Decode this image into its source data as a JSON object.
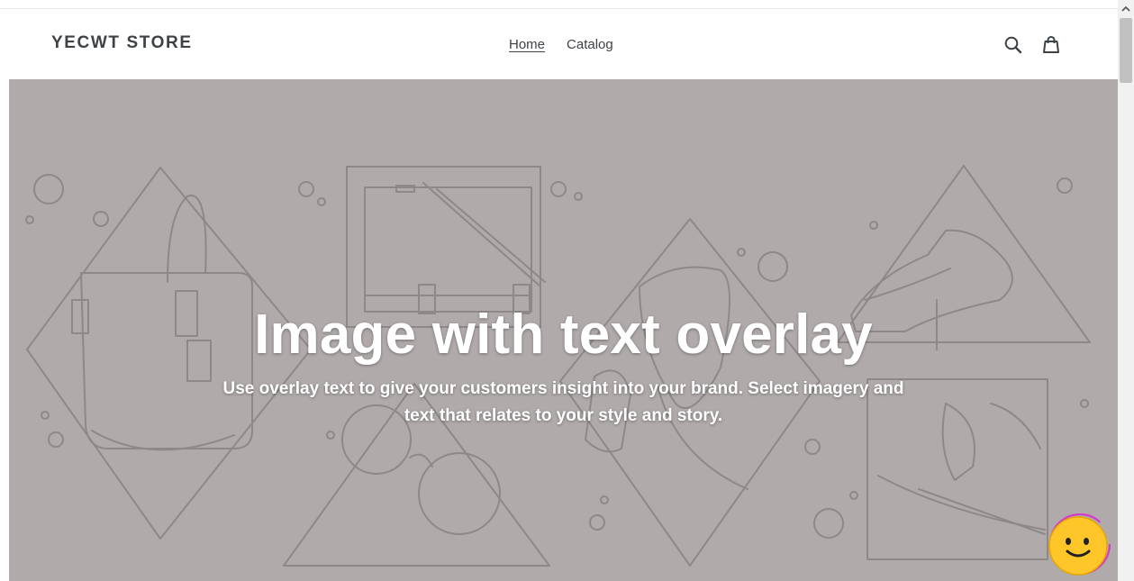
{
  "store": {
    "name": "YECWT STORE"
  },
  "nav": {
    "items": [
      {
        "label": "Home",
        "active": true
      },
      {
        "label": "Catalog",
        "active": false
      }
    ]
  },
  "header_icons": [
    "search-icon",
    "cart-icon"
  ],
  "hero": {
    "title": "Image with text overlay",
    "subtitle": "Use overlay text to give your customers insight into your brand. Select imagery and text that relates to your style and story.",
    "background_color": "#b0aaaa",
    "illustration_stroke": "#8e8888"
  },
  "chat_widget": {
    "icon": "smiley-chat-icon",
    "color": "#ffc629"
  }
}
